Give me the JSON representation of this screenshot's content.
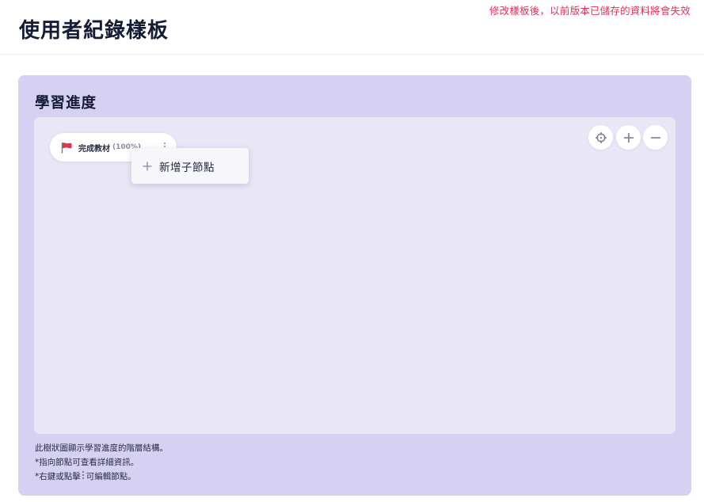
{
  "header": {
    "title": "使用者紀錄樣板",
    "warning": "修改樣板後，以前版本已儲存的資料將會失效"
  },
  "card": {
    "title": "學習進度",
    "controls": {
      "center": "crosshair-icon",
      "zoom_in": "plus-icon",
      "zoom_out": "minus-icon"
    },
    "node": {
      "icon": "flag-icon",
      "label": "完成教材",
      "progress": "(100%)"
    },
    "context_menu": {
      "items": [
        {
          "icon": "plus-icon",
          "label": "新增子節點"
        }
      ]
    },
    "notes": {
      "line1": "此樹狀圖顯示學習進度的階層結構。",
      "line2": "*指向節點可查看詳細資訊。",
      "line3_pre": "*右鍵或點擊",
      "line3_post": "可編輯節點。"
    }
  },
  "colors": {
    "warning": "#e3305a",
    "card_bg": "#d6d0f2",
    "canvas_bg": "#e9e7f6",
    "flag": "#e0344f"
  }
}
